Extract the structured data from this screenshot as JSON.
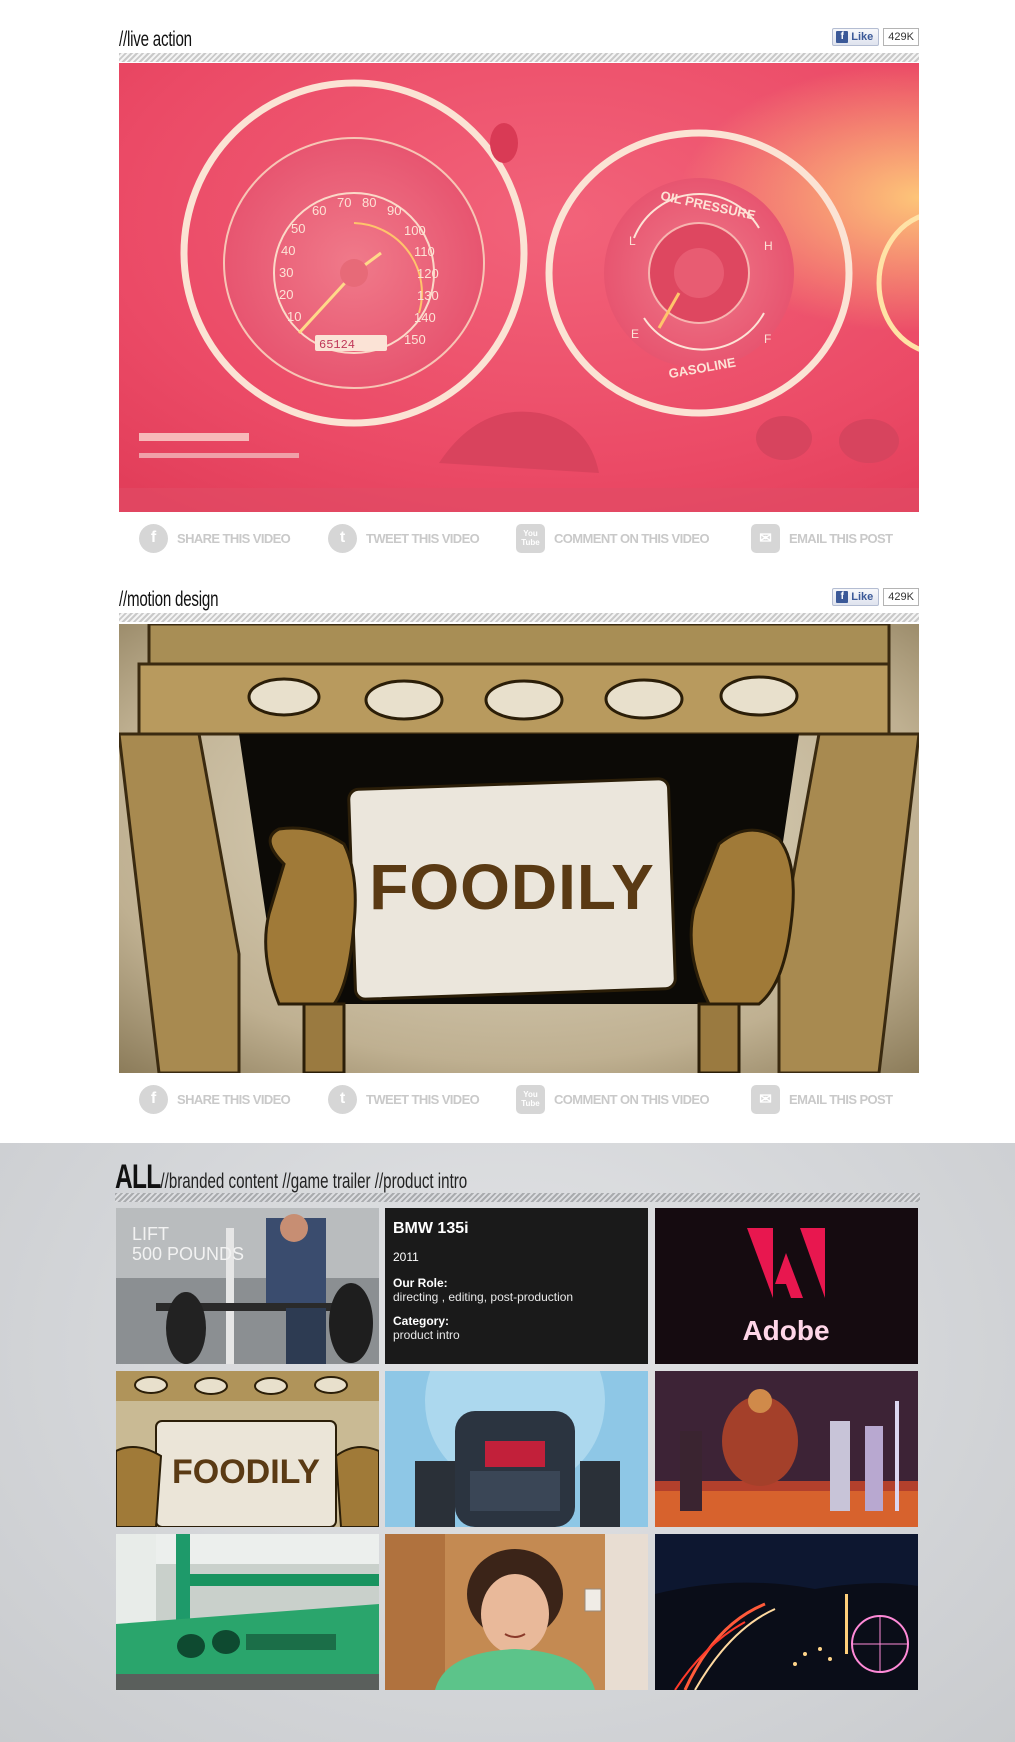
{
  "sections": [
    {
      "title": "//live action",
      "like_label": "Like",
      "like_count": "429K"
    },
    {
      "title": "//motion design",
      "like_label": "Like",
      "like_count": "429K"
    }
  ],
  "share": {
    "facebook": "SHARE THIS VIDEO",
    "twitter": "TWEET THIS VIDEO",
    "youtube": "COMMENT ON THIS VIDEO",
    "email": "EMAIL THIS POST",
    "youtube_icon_text": "You Tube"
  },
  "dashboard": {
    "speedometer_numbers": [
      "10",
      "20",
      "30",
      "40",
      "50",
      "60",
      "70",
      "80",
      "90",
      "100",
      "110",
      "120",
      "130",
      "140",
      "150"
    ],
    "odometer": "65124",
    "gauge_top": "OIL PRESSURE",
    "gauge_bottom": "GASOLINE",
    "gauge_l": "L",
    "gauge_h": "H",
    "gauge_e": "E",
    "gauge_f": "F"
  },
  "foodily_sign": "FOODILY",
  "all": {
    "label": "ALL",
    "filters": [
      "//branded content",
      "//game trailer",
      "//product intro"
    ]
  },
  "grid": {
    "lift_text_1": "LIFT",
    "lift_text_2": "500 POUNDS",
    "bmw": {
      "title": "BMW 135i",
      "year": "2011",
      "role_label": "Our Role:",
      "role_value": "directing , editing, post-production",
      "category_label": "Category:",
      "category_value": "product intro"
    },
    "adobe_text": "Adobe",
    "foodily_text": "FOODILY"
  },
  "colors": {
    "dashboard_pink": "#ee4a64",
    "foodily_brown": "#5a3a14",
    "share_gray": "#c9c9c9",
    "facebook_blue": "#3b5998"
  }
}
